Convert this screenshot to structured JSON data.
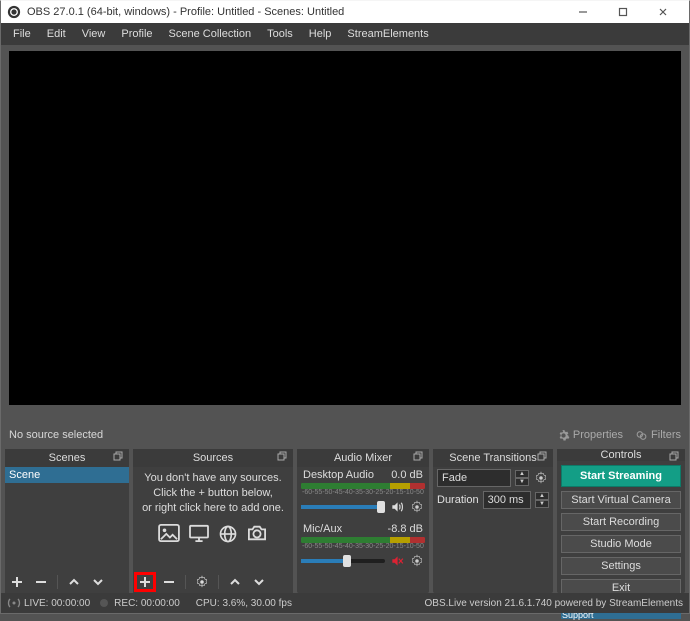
{
  "titlebar": {
    "text": "OBS 27.0.1 (64-bit, windows) - Profile: Untitled - Scenes: Untitled"
  },
  "menu": {
    "file": "File",
    "edit": "Edit",
    "view": "View",
    "profile": "Profile",
    "scene_collection": "Scene Collection",
    "tools": "Tools",
    "help": "Help",
    "stream_elements": "StreamElements"
  },
  "src_row": {
    "label": "No source selected",
    "properties": "Properties",
    "filters": "Filters"
  },
  "docks": {
    "scenes": {
      "title": "Scenes",
      "item": "Scene"
    },
    "sources": {
      "title": "Sources",
      "hint_l1": "You don't have any sources.",
      "hint_l2": "Click the + button below,",
      "hint_l3": "or right click here to add one."
    },
    "mixer": {
      "title": "Audio Mixer",
      "ch1": {
        "name": "Desktop Audio",
        "level": "0.0 dB"
      },
      "ch2": {
        "name": "Mic/Aux",
        "level": "-8.8 dB"
      },
      "ticks": [
        "-60",
        "-55",
        "-50",
        "-45",
        "-40",
        "-35",
        "-30",
        "-25",
        "-20",
        "-15",
        "-10",
        "-5",
        "0"
      ]
    },
    "transitions": {
      "title": "Scene Transitions",
      "fade": "Fade",
      "duration_label": "Duration",
      "duration_value": "300 ms"
    },
    "controls": {
      "title": "Controls",
      "start_streaming": "Start Streaming",
      "start_virtual_cam": "Start Virtual Camera",
      "start_recording": "Start Recording",
      "studio_mode": "Studio Mode",
      "settings": "Settings",
      "exit": "Exit",
      "se_support": "StreamElements Live Support"
    }
  },
  "status": {
    "live": "LIVE: 00:00:00",
    "rec": "REC: 00:00:00",
    "cpu": "CPU: 3.6%, 30.00 fps",
    "version": "OBS.Live version 21.6.1.740 powered by StreamElements"
  }
}
